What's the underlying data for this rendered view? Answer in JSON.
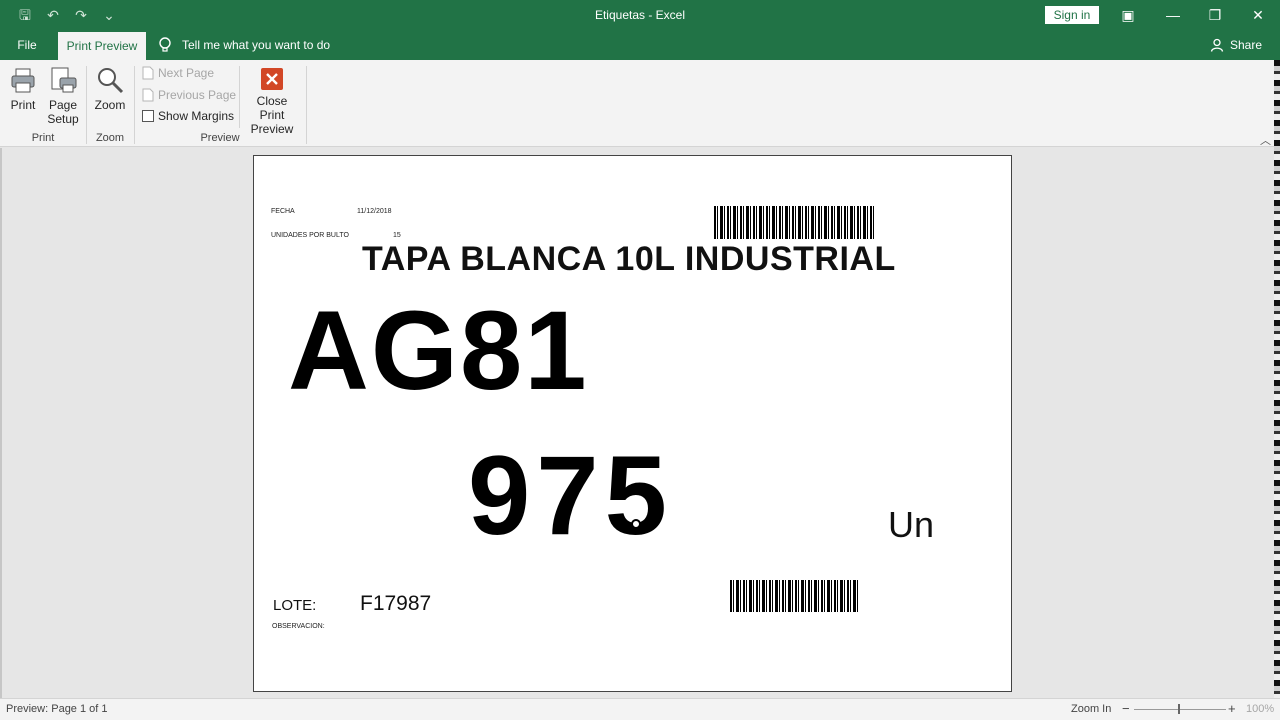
{
  "window": {
    "title": "Etiquetas  -  Excel",
    "sign_in": "Sign in",
    "minimize": "—",
    "restore": "❐",
    "close": "✕",
    "ribbon_display": "▣"
  },
  "qat": {
    "save": "🖫",
    "undo": "↶",
    "redo": "↷",
    "customize": "⌄"
  },
  "tabs": {
    "file": "File",
    "print_preview": "Print Preview",
    "tell_me": "Tell me what you want to do",
    "share": "Share"
  },
  "ribbon": {
    "print": {
      "label": "Print",
      "group": "Print"
    },
    "page_setup": {
      "line1": "Page",
      "line2": "Setup"
    },
    "zoom": {
      "label": "Zoom",
      "group": "Zoom"
    },
    "preview": {
      "next_page": "Next Page",
      "previous_page": "Previous Page",
      "show_margins": "Show Margins",
      "close_line1": "Close Print",
      "close_line2": "Preview",
      "group": "Preview"
    }
  },
  "label": {
    "fecha_label": "FECHA",
    "fecha_value": "11/12/2018",
    "unidades_label": "UNIDADES POR BULTO",
    "unidades_value": "15",
    "product": "TAPA BLANCA 10L INDUSTRIAL",
    "code": "AG81",
    "quantity": "975",
    "unit": "Un",
    "lote_label": "LOTE:",
    "lote_value": "F17987",
    "observacion_label": "OBSERVACION:"
  },
  "status": {
    "preview_info": "Preview: Page 1 of 1",
    "zoom_in": "Zoom In",
    "zoom_percent": "100%"
  },
  "colors": {
    "excel_green": "#217346",
    "close_red": "#d24726"
  }
}
